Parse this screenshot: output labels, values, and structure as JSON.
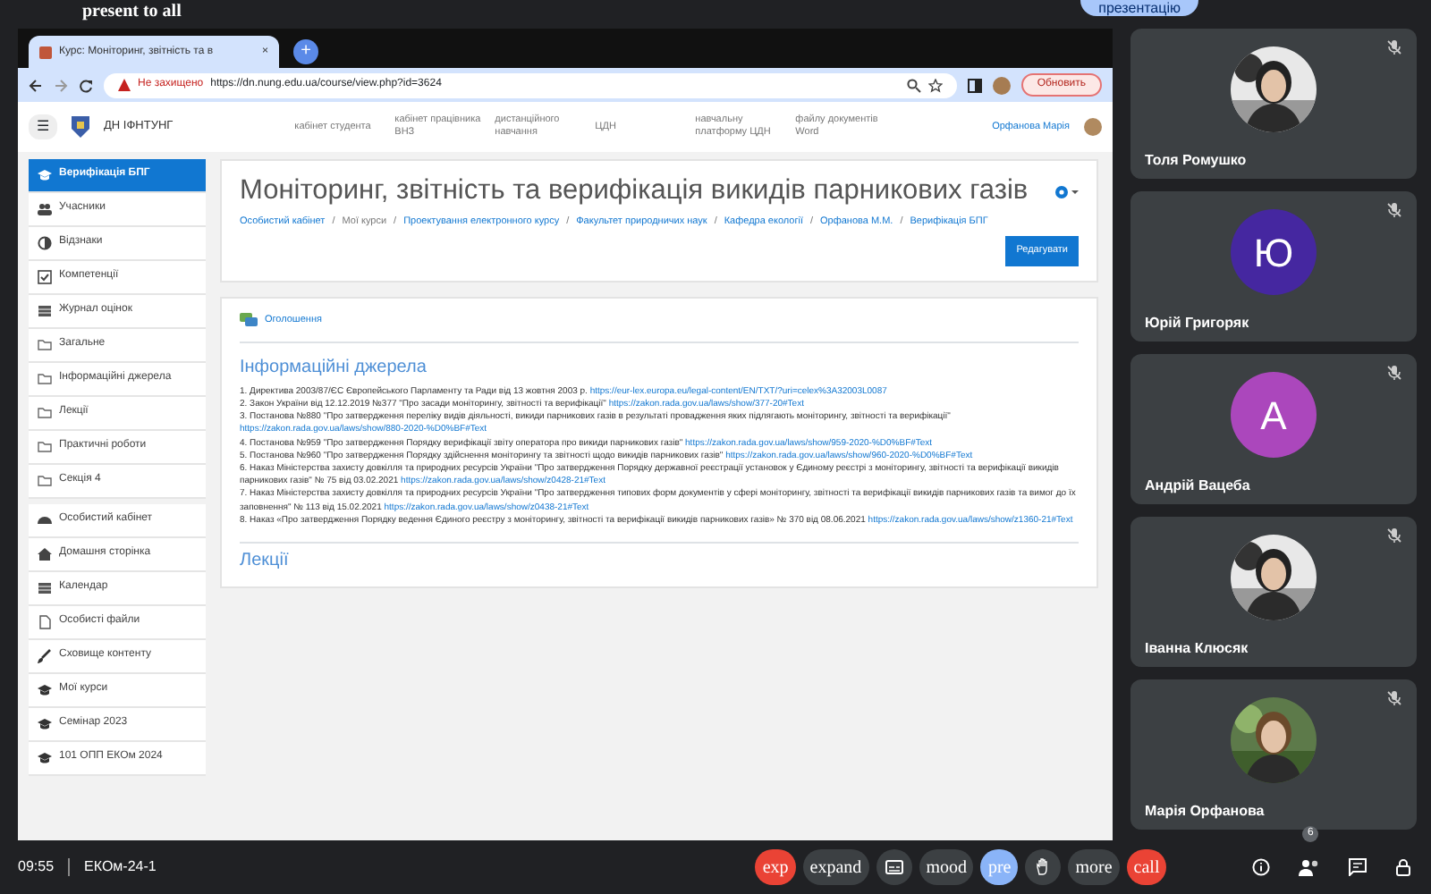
{
  "meet_top": {
    "present_label": "present to all",
    "present_button": "презентацію"
  },
  "browser": {
    "tab_title": "Курс: Моніторинг, звітність та в",
    "tab_close": "×",
    "new_tab": "+",
    "security": "Не захищено",
    "url": "https://dn.nung.edu.ua/course/view.php?id=3624",
    "update_button": "Обновить"
  },
  "site": {
    "logo": "ДН ІФНТУНГ",
    "menu_glyph": "☰",
    "top_links": [
      {
        "text": "кабінет студента"
      },
      {
        "text": "кабінет працівника ВНЗ"
      },
      {
        "text": "дистанційного навчання"
      },
      {
        "text": "ЦДН"
      },
      {
        "text": "навчальну платформу ЦДН"
      },
      {
        "text": "файлу документів Word"
      }
    ],
    "user_name": "Орфанова Марія"
  },
  "sidebar": {
    "items": [
      {
        "label": "Верифікація БПГ",
        "kind": "course",
        "selected": true
      },
      {
        "label": "Учасники",
        "kind": "users",
        "selected": false
      },
      {
        "label": "Відзнаки",
        "kind": "badge",
        "selected": false
      },
      {
        "label": "Компетенції",
        "kind": "check",
        "selected": false
      },
      {
        "label": "Журнал оцінок",
        "kind": "table",
        "selected": false
      },
      {
        "label": "Загальне",
        "kind": "folder",
        "selected": false
      },
      {
        "label": "Інформаційні джерела",
        "kind": "folder",
        "selected": false
      },
      {
        "label": "Лекції",
        "kind": "folder",
        "selected": false
      },
      {
        "label": "Практичні роботи",
        "kind": "folder",
        "selected": false
      },
      {
        "label": "Секція 4",
        "kind": "folder",
        "selected": false
      },
      {
        "label": "Особистий кабінет",
        "kind": "dashboard",
        "selected": false
      },
      {
        "label": "Домашня сторінка",
        "kind": "home",
        "selected": false
      },
      {
        "label": "Календар",
        "kind": "table",
        "selected": false
      },
      {
        "label": "Особисті файли",
        "kind": "file",
        "selected": false
      },
      {
        "label": "Сховище контенту",
        "kind": "brush",
        "selected": false
      },
      {
        "label": "Мої курси",
        "kind": "course",
        "selected": false
      },
      {
        "label": "Семінар 2023",
        "kind": "course",
        "selected": false
      },
      {
        "label": "101 ОПП ЕКОм 2024",
        "kind": "course",
        "selected": false
      }
    ]
  },
  "course": {
    "title": "Моніторинг, звітність та верифікація викидів парникових газів",
    "breadcrumb_separator": "/",
    "breadcrumbs": [
      {
        "text": "Особистий кабінет",
        "link": true
      },
      {
        "text": "Мої курси",
        "link": false
      },
      {
        "text": "Проектування електронного курсу",
        "link": true
      },
      {
        "text": "Факультет природничих наук",
        "link": true
      },
      {
        "text": "Кафедра екології",
        "link": true
      },
      {
        "text": "Орфанова М.М.",
        "link": true
      },
      {
        "text": "Верифікація БПГ",
        "link": true
      }
    ],
    "edit_button": "Редагувати",
    "announcements": "Оголошення",
    "section_title": "Інформаційні джерела",
    "sources": [
      {
        "text": "1. Директива 2003/87/ЄС Європейського Парламенту та Ради від 13 жовтня 2003 р.",
        "link": "https://eur-lex.europa.eu/legal-content/EN/TXT/?uri=celex%3A32003L0087"
      },
      {
        "text": "2. Закон України від 12.12.2019 №377 \"Про засади моніторингу, звітності та верифікації\"",
        "link": "https://zakon.rada.gov.ua/laws/show/377-20#Text"
      },
      {
        "text": "3. Постанова №880 \"Про затвердження переліку видів діяльності, викиди парникових газів в результаті провадження яких підлягають моніторингу, звітності та верифікації\"",
        "link": "https://zakon.rada.gov.ua/laws/show/880-2020-%D0%BF#Text"
      },
      {
        "text": "4. Постанова №959 \"Про затвердження Порядку верифікації звіту оператора про викиди парникових газів\"",
        "link": "https://zakon.rada.gov.ua/laws/show/959-2020-%D0%BF#Text"
      },
      {
        "text": "5. Постанова №960 \"Про затвердження Порядку здійснення моніторингу та звітності щодо викидів парникових газів\"",
        "link": "https://zakon.rada.gov.ua/laws/show/960-2020-%D0%BF#Text"
      },
      {
        "text": "6. Наказ Міністерства захисту довкілля та природних ресурсів України \"Про затвердження Порядку державної реєстрації установок у Єдиному реєстрі з моніторингу, звітності та верифікації викидів парникових газів\" № 75 від 03.02.2021",
        "link": "https://zakon.rada.gov.ua/laws/show/z0428-21#Text"
      },
      {
        "text": "7. Наказ Міністерства захисту довкілля та природних ресурсів України \"Про затвердження типових форм документів у сфері моніторингу, звітності та верифікації викидів парникових газів та вимог до їх заповнення\" № 113 від 15.02.2021",
        "link": "https://zakon.rada.gov.ua/laws/show/z0438-21#Text"
      },
      {
        "text": "8. Наказ «Про затвердження Порядку ведення Єдиного реєстру з моніторингу, звітності та верифікації викидів парникових газів» № 370 від 08.06.2021",
        "link": "https://zakon.rada.gov.ua/laws/show/z1360-21#Text"
      }
    ],
    "next_section": "Лекції"
  },
  "participants": [
    {
      "name": "Толя Ромушко",
      "kind": "picture",
      "muted": true
    },
    {
      "name": "Юрій Григоряк",
      "kind": "letter",
      "letter": "Ю",
      "color": "#4527a0",
      "muted": true
    },
    {
      "name": "Андрій Вацеба",
      "kind": "letter",
      "letter": "А",
      "color": "#ab47bc",
      "muted": true
    },
    {
      "name": "Іванна Клюсяк",
      "kind": "picture",
      "muted": true
    },
    {
      "name": "Марія Орфанова",
      "kind": "picture",
      "muted": true
    }
  ],
  "meeting": {
    "time": "09:55",
    "code": "ЕКОм-24-1",
    "controls": [
      {
        "kind": "text",
        "label": "exp",
        "color": "#ea4335"
      },
      {
        "kind": "text",
        "label": "expand",
        "color": "#3c4043"
      },
      {
        "kind": "captions",
        "color": "#3c4043"
      },
      {
        "kind": "text",
        "label": "mood",
        "color": "#3c4043"
      },
      {
        "kind": "text",
        "label": "pre",
        "color": "#8ab4f8"
      },
      {
        "kind": "hand",
        "color": "#3c4043"
      },
      {
        "kind": "text",
        "label": "more",
        "color": "#3c4043"
      },
      {
        "kind": "text",
        "label": "call",
        "color": "#ea4335"
      }
    ],
    "people_count": "6"
  }
}
